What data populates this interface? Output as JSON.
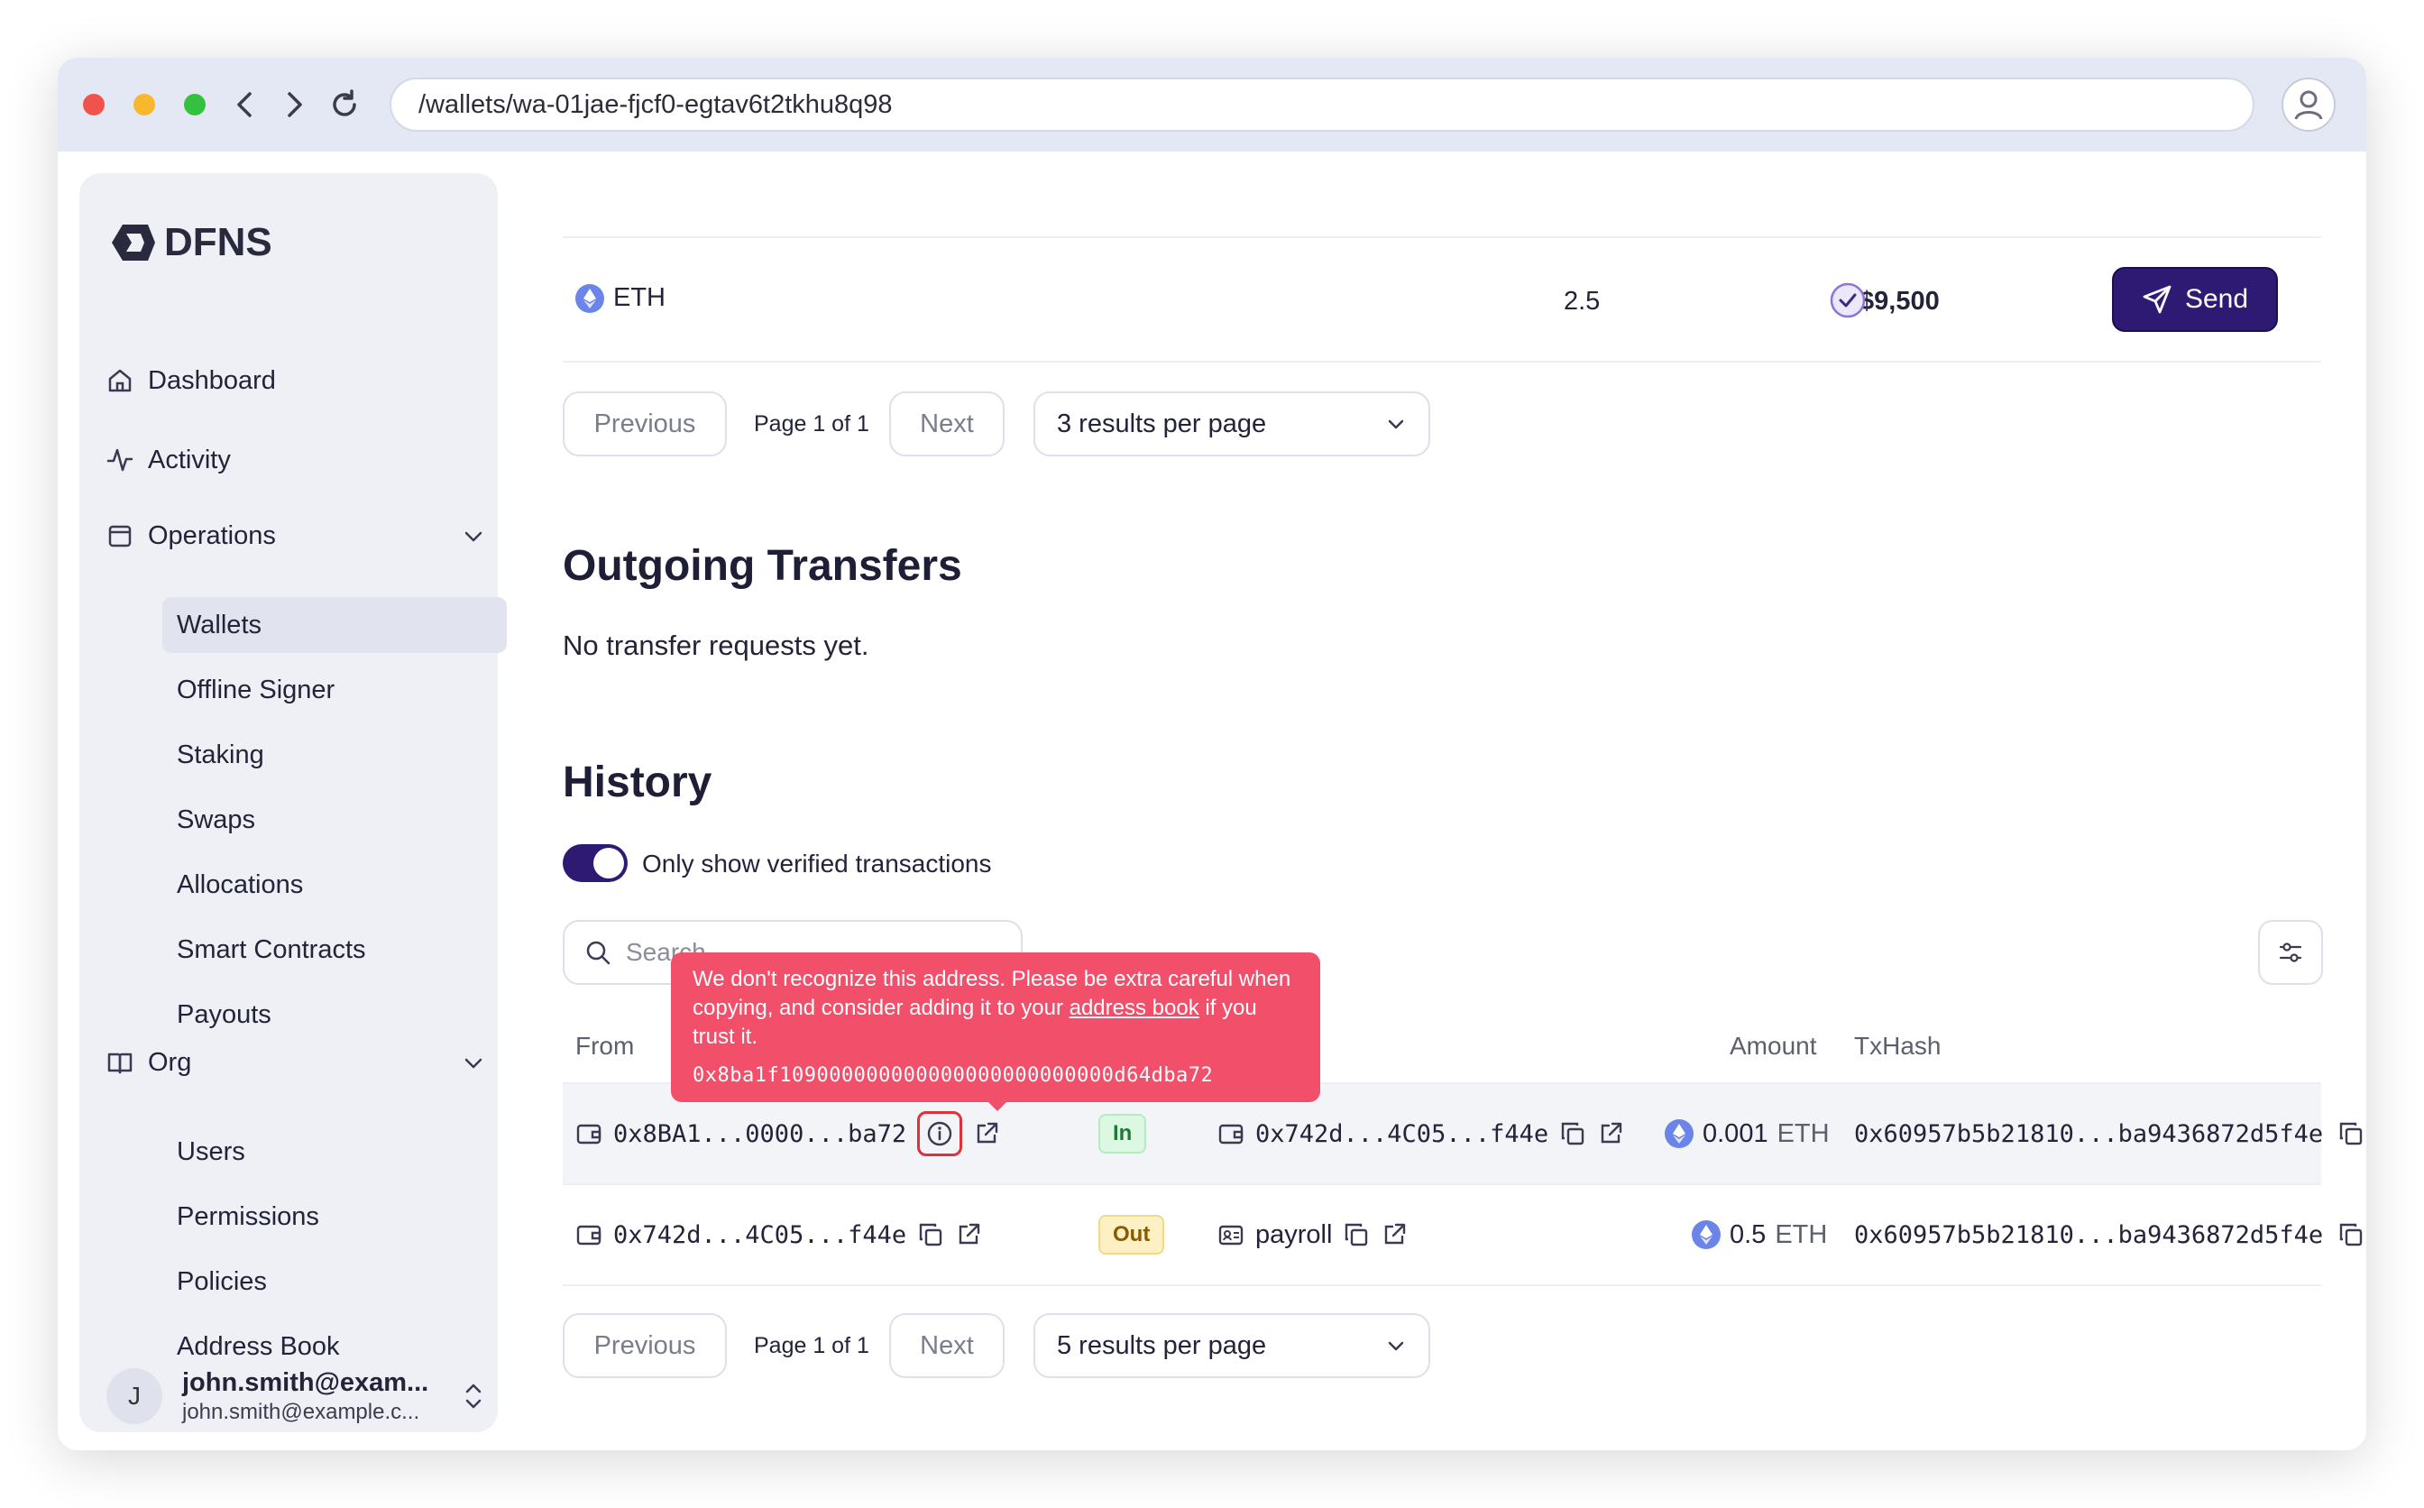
{
  "browser": {
    "url": "/wallets/wa-01jae-fjcf0-egtav6t2tkhu8q98"
  },
  "sidebar": {
    "logo": "DFNS",
    "items": {
      "dashboard": "Dashboard",
      "activity": "Activity",
      "operations": "Operations",
      "org": "Org"
    },
    "operations_sub": [
      "Wallets",
      "Offline Signer",
      "Staking",
      "Swaps",
      "Allocations",
      "Smart Contracts",
      "Payouts"
    ],
    "org_sub": [
      "Users",
      "Permissions",
      "Policies",
      "Address Book"
    ],
    "user": {
      "initial": "J",
      "name": "john.smith@exam...",
      "email": "john.smith@example.c..."
    }
  },
  "assets": {
    "row": {
      "symbol": "ETH",
      "balance": "2.5",
      "value": "$9,500"
    },
    "send_label": "Send",
    "pager": {
      "previous": "Previous",
      "page": "Page 1 of 1",
      "next": "Next",
      "per_page": "3 results per page"
    }
  },
  "outgoing": {
    "title": "Outgoing Transfers",
    "empty": "No transfer requests yet."
  },
  "history": {
    "title": "History",
    "toggle_label": "Only show verified transactions",
    "search_placeholder": "Search",
    "columns": {
      "from": "From",
      "amount": "Amount",
      "txhash": "TxHash"
    },
    "rows": [
      {
        "from": "0x8BA1...0000...ba72",
        "direction": "In",
        "to": "0x742d...4C05...f44e",
        "amount": "0.001",
        "unit": "ETH",
        "txhash": "0x60957b5b21810...ba9436872d5f4e"
      },
      {
        "from": "0x742d...4C05...f44e",
        "direction": "Out",
        "to": "payroll",
        "amount": "0.5",
        "unit": "ETH",
        "txhash": "0x60957b5b21810...ba9436872d5f4e"
      }
    ],
    "pager": {
      "previous": "Previous",
      "page": "Page 1 of 1",
      "next": "Next",
      "per_page": "5 results per page"
    }
  },
  "tooltip": {
    "text_before": "We don't recognize this address. Please be extra careful when copying, and consider adding it to your ",
    "link": "address book",
    "text_after": " if you trust it.",
    "address": "0x8ba1f109000000000000000000000000d64dba72"
  },
  "colors": {
    "accent": "#2f1a73",
    "tooltip": "#f24f6a",
    "badge_in": "#dcf7e2",
    "badge_out": "#fdf0c2"
  }
}
